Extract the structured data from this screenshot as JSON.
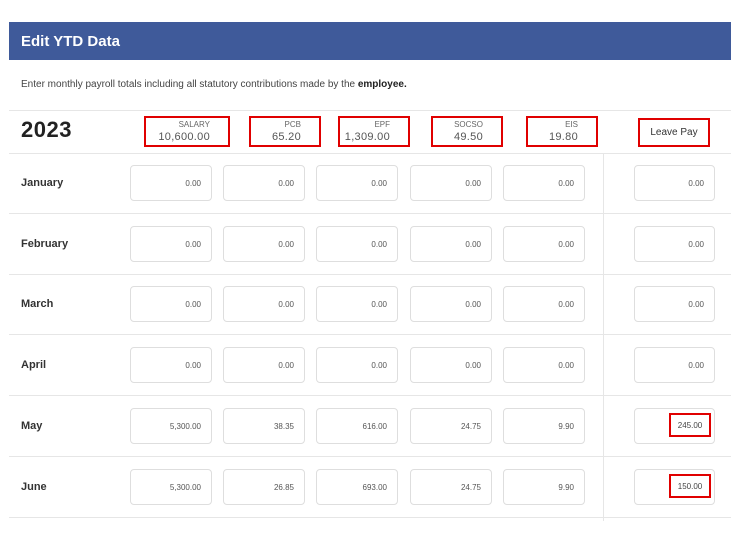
{
  "header": {
    "title": "Edit YTD Data"
  },
  "description": {
    "text": "Enter monthly payroll totals including all statutory contributions made by the ",
    "emphasis": "employee."
  },
  "year": "2023",
  "totals": [
    {
      "label": "SALARY",
      "value": "10,600.00"
    },
    {
      "label": "PCB",
      "value": "65.20"
    },
    {
      "label": "EPF",
      "value": "1,309.00"
    },
    {
      "label": "SOCSO",
      "value": "49.50"
    },
    {
      "label": "EIS",
      "value": "19.80"
    }
  ],
  "leave_pay_label": "Leave Pay",
  "months": [
    {
      "name": "January",
      "values": [
        "0.00",
        "0.00",
        "0.00",
        "0.00",
        "0.00"
      ],
      "leave_pay": "0.00"
    },
    {
      "name": "February",
      "values": [
        "0.00",
        "0.00",
        "0.00",
        "0.00",
        "0.00"
      ],
      "leave_pay": "0.00"
    },
    {
      "name": "March",
      "values": [
        "0.00",
        "0.00",
        "0.00",
        "0.00",
        "0.00"
      ],
      "leave_pay": "0.00"
    },
    {
      "name": "April",
      "values": [
        "0.00",
        "0.00",
        "0.00",
        "0.00",
        "0.00"
      ],
      "leave_pay": "0.00"
    },
    {
      "name": "May",
      "values": [
        "5,300.00",
        "38.35",
        "616.00",
        "24.75",
        "9.90"
      ],
      "leave_pay": "245.00"
    },
    {
      "name": "June",
      "values": [
        "5,300.00",
        "26.85",
        "693.00",
        "24.75",
        "9.90"
      ],
      "leave_pay": "150.00"
    }
  ],
  "highlight_color": "#e00000",
  "header_color": "#3f5a9a"
}
